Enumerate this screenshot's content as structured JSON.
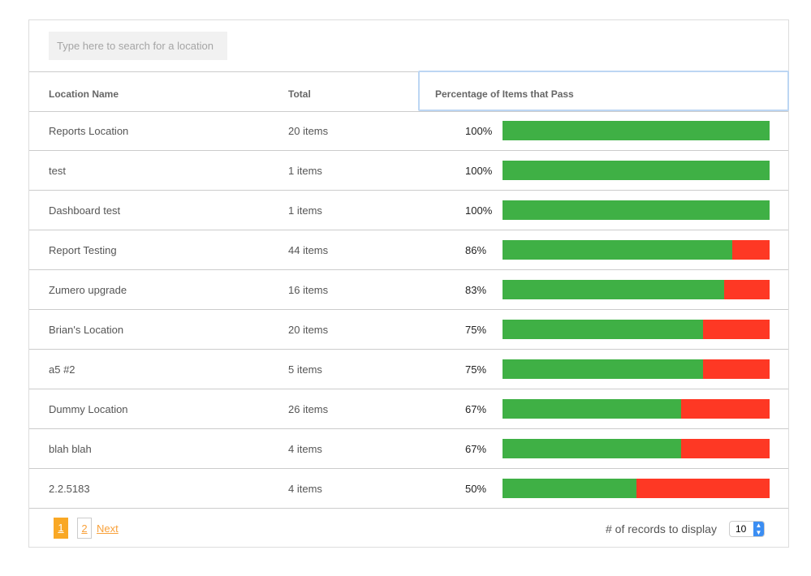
{
  "search": {
    "placeholder": "Type here to search for a location"
  },
  "table": {
    "headers": [
      "Location Name",
      "Total",
      "Percentage of Items that Pass"
    ],
    "rows": [
      {
        "name": "Reports Location",
        "total": "20 items",
        "percent": 100
      },
      {
        "name": "test",
        "total": "1 items",
        "percent": 100
      },
      {
        "name": "Dashboard test",
        "total": "1 items",
        "percent": 100
      },
      {
        "name": "Report Testing",
        "total": "44 items",
        "percent": 86
      },
      {
        "name": "Zumero upgrade",
        "total": "16 items",
        "percent": 83
      },
      {
        "name": "Brian's Location",
        "total": "20 items",
        "percent": 75
      },
      {
        "name": "a5 #2",
        "total": "5 items",
        "percent": 75
      },
      {
        "name": "Dummy Location",
        "total": "26 items",
        "percent": 67
      },
      {
        "name": "blah blah",
        "total": "4 items",
        "percent": 67
      },
      {
        "name": "2.2.5183",
        "total": "4 items",
        "percent": 50
      }
    ]
  },
  "colors": {
    "pass": "#3fb045",
    "fail": "#fe3824",
    "accent": "#f9a825"
  },
  "pagination": {
    "pages": [
      "1",
      "2"
    ],
    "current": "1",
    "next_label": "Next"
  },
  "records": {
    "label": "# of records to display",
    "value": "10"
  }
}
